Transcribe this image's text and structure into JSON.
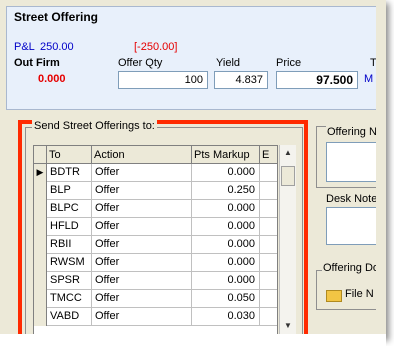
{
  "panel": {
    "title": "Street Offering",
    "pl_label": "P&L",
    "pl_value": "250.00",
    "pl_neg": "[-250.00]",
    "out_firm_label": "Out Firm",
    "out_firm_value": "0.000",
    "offer_qty_label": "Offer Qty",
    "offer_qty_value": "100",
    "yield_label": "Yield",
    "yield_value": "4.837",
    "price_label": "Price",
    "price_value": "97.500",
    "partial_letter": "M",
    "partial_to": "To"
  },
  "send": {
    "group_label": "Send Street Offerings to:",
    "columns": [
      "To",
      "Action",
      "Pts Markup",
      "E"
    ],
    "rows": [
      {
        "to": "BDTR",
        "action": "Offer",
        "markup": "0.000",
        "selected": true
      },
      {
        "to": "BLP",
        "action": "Offer",
        "markup": "0.250",
        "selected": false
      },
      {
        "to": "BLPC",
        "action": "Offer",
        "markup": "0.000",
        "selected": false
      },
      {
        "to": "HFLD",
        "action": "Offer",
        "markup": "0.000",
        "selected": false
      },
      {
        "to": "RBII",
        "action": "Offer",
        "markup": "0.000",
        "selected": false
      },
      {
        "to": "RWSM",
        "action": "Offer",
        "markup": "0.000",
        "selected": false
      },
      {
        "to": "SPSR",
        "action": "Offer",
        "markup": "0.000",
        "selected": false
      },
      {
        "to": "TMCC",
        "action": "Offer",
        "markup": "0.050",
        "selected": false
      },
      {
        "to": "VABD",
        "action": "Offer",
        "markup": "0.030",
        "selected": false
      }
    ]
  },
  "right": {
    "offering_notes_label": "Offering No",
    "desk_notes_label": "Desk Note",
    "offering_docs_label": "Offering Do",
    "file_label": "File N"
  },
  "colors": {
    "highlight_border": "#ff2a00",
    "blue_text": "#0000c8",
    "red_text": "#e60000"
  }
}
